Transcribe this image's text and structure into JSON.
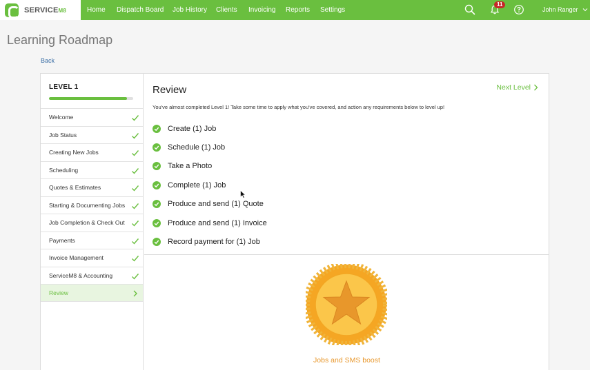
{
  "nav": {
    "brand": "SERVICE",
    "brand_suffix": "M8",
    "items": [
      {
        "label": "Home"
      },
      {
        "label": "Dispatch Board"
      },
      {
        "label": "Job History"
      },
      {
        "label": "Clients"
      },
      {
        "label": "Invoicing"
      },
      {
        "label": "Reports"
      },
      {
        "label": "Settings"
      }
    ],
    "notification_count": "11",
    "user": "John Ranger",
    "icons": [
      "search-icon",
      "bell-icon",
      "help-icon",
      "chevron-down-icon"
    ]
  },
  "page": {
    "title": "Learning Roadmap",
    "back": "Back"
  },
  "sidebar": {
    "level": "LEVEL 1",
    "progress": 0.93,
    "items": [
      {
        "label": "Welcome",
        "status": "complete"
      },
      {
        "label": "Job Status",
        "status": "complete"
      },
      {
        "label": "Creating New Jobs",
        "status": "complete"
      },
      {
        "label": "Scheduling",
        "status": "complete"
      },
      {
        "label": "Quotes & Estimates",
        "status": "complete"
      },
      {
        "label": "Starting & Documenting Jobs",
        "status": "complete"
      },
      {
        "label": "Job Completion & Check Out",
        "status": "complete"
      },
      {
        "label": "Payments",
        "status": "complete"
      },
      {
        "label": "Invoice Management",
        "status": "complete"
      },
      {
        "label": "ServiceM8 & Accounting",
        "status": "complete"
      },
      {
        "label": "Review",
        "status": "active"
      }
    ]
  },
  "review": {
    "title": "Review",
    "next_level": "Next Level",
    "intro": "You've almost completed Level 1! Take some time to apply what you've covered, and action any requirements below to level up!",
    "tasks": [
      {
        "label": "Create (1) Job"
      },
      {
        "label": "Schedule (1) Job"
      },
      {
        "label": "Take a Photo"
      },
      {
        "label": "Complete (1) Job"
      },
      {
        "label": "Produce and send (1) Quote"
      },
      {
        "label": "Produce and send (1) Invoice"
      },
      {
        "label": "Record payment for (1) Job"
      }
    ],
    "reward": "Jobs and SMS boost"
  },
  "colors": {
    "brand_green": "#6abf3f",
    "reward_orange": "#e8972b",
    "badge_red": "#c62828",
    "link_blue": "#3a6ea5"
  }
}
